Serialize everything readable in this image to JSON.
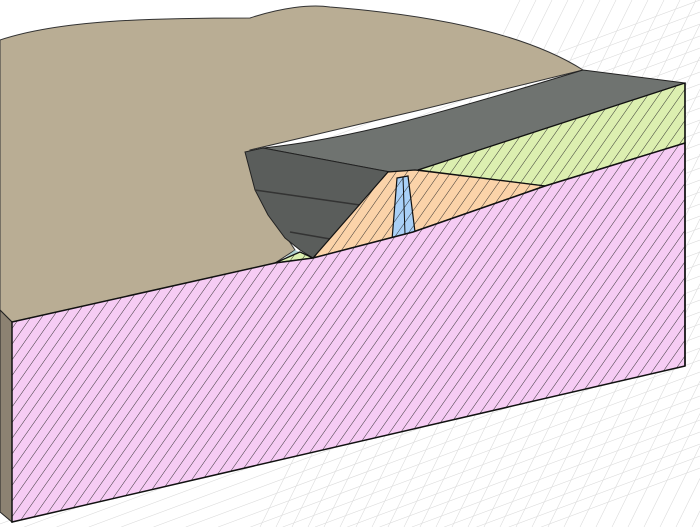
{
  "scene": {
    "description_type": "3d-geological-cross-section",
    "colors": {
      "terrain": "#b9ad94",
      "reservoir_surface": "#6f7370",
      "dam_face": "#5a5d5b",
      "foundation_rock": "#f6ccf4",
      "upper_soil_layer": "#dcefb0",
      "dam_shell": "#fbd3a9",
      "dam_core": "#a9d0f7",
      "grid": "#dcdcdc"
    }
  }
}
